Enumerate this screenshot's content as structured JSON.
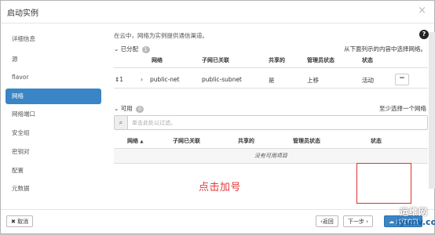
{
  "title": "启动实例",
  "close_glyph": "×",
  "sidebar": {
    "items": [
      {
        "label": "详细信息"
      },
      {
        "label": "源"
      },
      {
        "label": "flavor"
      },
      {
        "label": "网络",
        "active": true
      },
      {
        "label": "网络端口"
      },
      {
        "label": "安全组"
      },
      {
        "label": "密钥对"
      },
      {
        "label": "配置"
      },
      {
        "label": "元数据"
      }
    ]
  },
  "content": {
    "description": "在云中，网络为实例提供通信渠道。",
    "help_glyph": "?",
    "allocated": {
      "label": "已分配",
      "count": "1",
      "hint": "从下面列示的内容中选择网络。",
      "columns": [
        "网络",
        "子网已关联",
        "共享的",
        "管理员状态",
        "状态"
      ],
      "rows": [
        {
          "order": "1",
          "network": "public-net",
          "subnet": "public-subnet",
          "shared": "是",
          "admin_state": "上移",
          "status": "活动",
          "action": "−"
        }
      ]
    },
    "available": {
      "label": "可用",
      "count": "0",
      "hint": "至少选择一个网络",
      "search_placeholder": "单击此处以过滤。",
      "columns": [
        "网络",
        "子网已关联",
        "共享的",
        "管理员状态",
        "状态"
      ],
      "sort_indicator": "▲",
      "empty_text": "没有可用项目"
    }
  },
  "annotation": {
    "text": "点击加号",
    "color": "#e13a3a"
  },
  "footer": {
    "cancel_label": "取消",
    "back_label": "‹返回",
    "next_label": "下一步 ›",
    "launch_label": "启动实例"
  },
  "watermark": {
    "line1": "运维网",
    "line2": "iyunv.com"
  },
  "colors": {
    "accent": "#3a85c5",
    "annotation": "#e13a3a"
  }
}
